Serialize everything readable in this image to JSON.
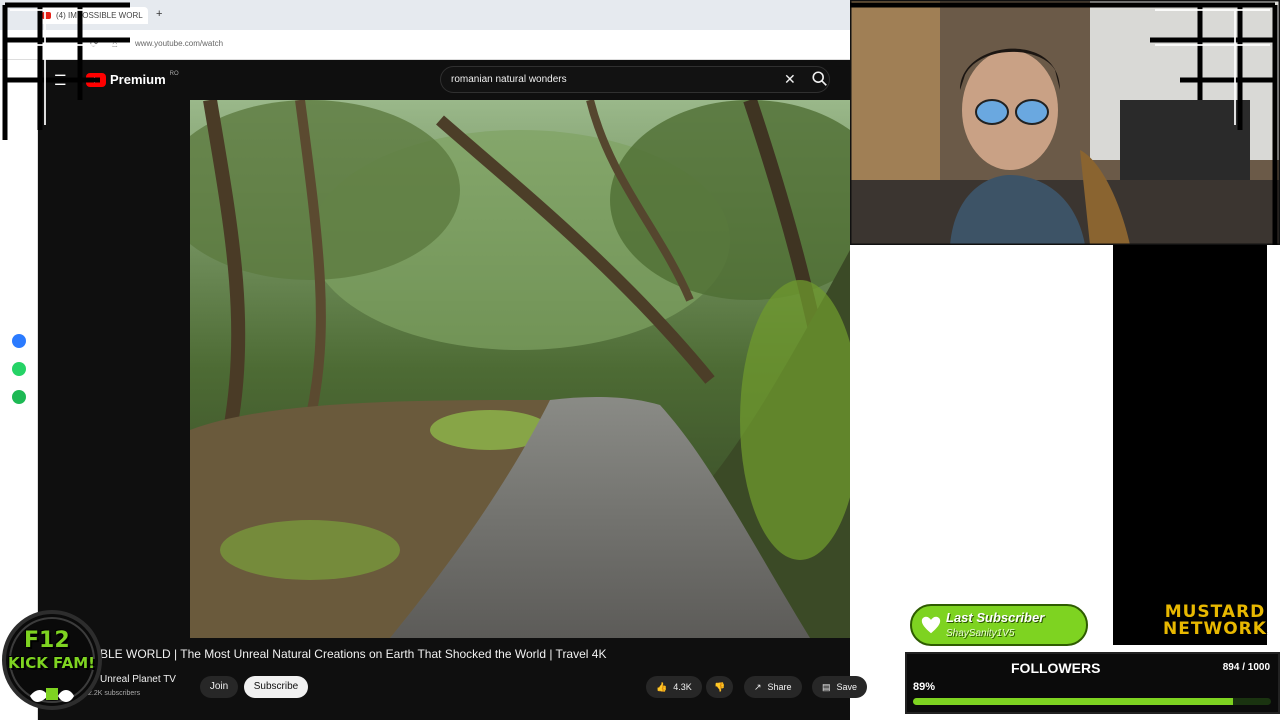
{
  "browser": {
    "tab_title": "(4) IMPOSSIBLE WORL",
    "new_tab_symbol": "+",
    "url": "www.youtube.com/watch"
  },
  "youtube": {
    "logo_text": "Premium",
    "country_code": "RO",
    "search_query": "romanian natural wonders",
    "video_title": "BLE WORLD | The Most Unreal Natural Creations on Earth That Shocked the World | Travel 4K",
    "channel_name": "Unreal Planet TV",
    "subscriber_count": "2.2K subscribers",
    "join_label": "Join",
    "subscribe_label": "Subscribe",
    "like_count": "4.3K",
    "share_label": "Share",
    "save_label": "Save",
    "colors": {
      "bg": "#0f0f0f",
      "brand_red": "#ff0000"
    }
  },
  "overlay": {
    "last_subscriber_title": "Last Subscriber",
    "last_subscriber_name": "ShaySanity1V5",
    "brand_text_line1": "MUSTARD",
    "brand_text_line2": "NETWORK",
    "followers_label": "FOLLOWERS",
    "followers_count": "894 / 1000",
    "followers_pct_text": "89%",
    "followers_fraction": 0.894,
    "badge_top": "F12",
    "badge_bottom": "KICK FAM!",
    "accent": "#7ed321"
  },
  "dock": {
    "icons": [
      "messenger-icon",
      "whatsapp-icon",
      "spotify-icon"
    ]
  }
}
